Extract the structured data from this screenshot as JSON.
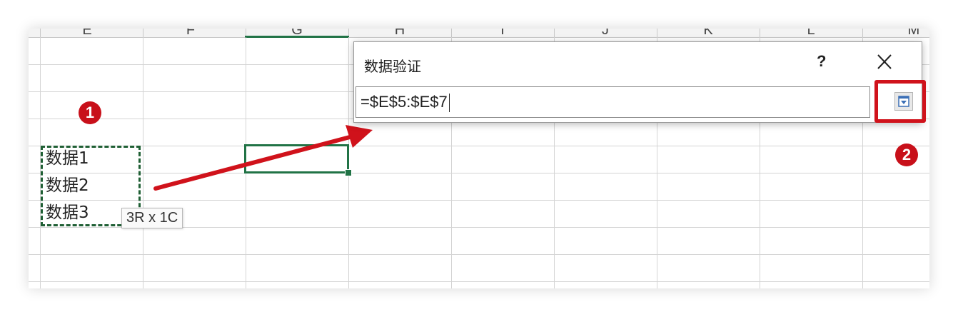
{
  "columns": [
    "E",
    "F",
    "G",
    "H",
    "I",
    "J",
    "K",
    "L",
    "M"
  ],
  "cells": [
    "数据1",
    "数据2",
    "数据3"
  ],
  "selection_size_tip": "3R x 1C",
  "dialog": {
    "title": "数据验证",
    "help_label": "?",
    "reference_value": "=$E$5:$E$7"
  },
  "annotations": {
    "step1": "1",
    "step2": "2"
  },
  "colors": {
    "excel_green": "#217346",
    "annotation_red": "#d0121b"
  }
}
